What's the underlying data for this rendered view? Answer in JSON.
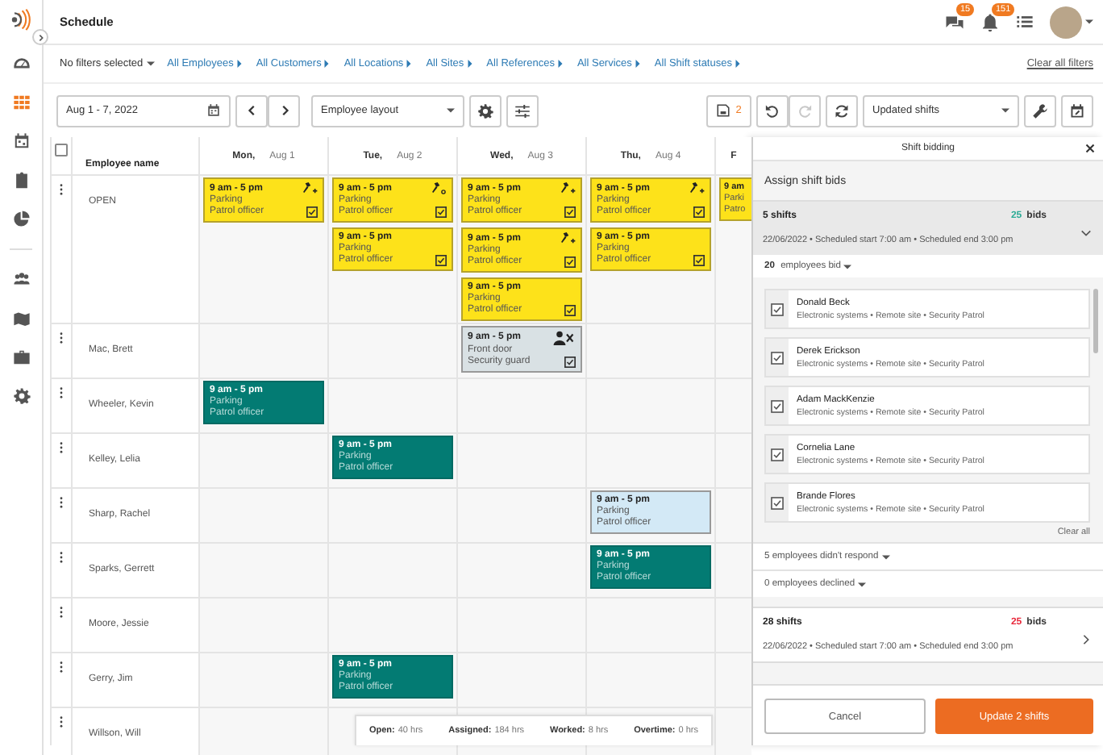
{
  "app": {
    "title": "Schedule"
  },
  "rail": [
    {
      "kind": "gauge",
      "selected": false
    },
    {
      "kind": "grid",
      "selected": true
    },
    {
      "kind": "calendar",
      "selected": false
    },
    {
      "kind": "clipboard",
      "selected": false
    },
    {
      "kind": "pie",
      "selected": false
    },
    {
      "kind": "people",
      "selected": false
    },
    {
      "kind": "map",
      "selected": false
    },
    {
      "kind": "briefcase",
      "selected": false
    },
    {
      "kind": "gear",
      "selected": false
    }
  ],
  "header": {
    "messages_badge": "15",
    "alerts_badge": "151"
  },
  "filters": {
    "summary": "No filters selected",
    "links": [
      "All Employees",
      "All Customers",
      "All Locations",
      "All Sites",
      "All References",
      "All Services",
      "All Shift statuses"
    ],
    "clear": "Clear all filters"
  },
  "toolbar": {
    "date_range": "Aug 1 - 7, 2022",
    "layout": "Employee layout",
    "unsaved_count": "2",
    "redo_disabled": true,
    "view": "Updated shifts"
  },
  "schedule": {
    "all_selected": false,
    "name_header": "Employee name",
    "days": [
      {
        "day": "Mon,",
        "date": "Aug 1"
      },
      {
        "day": "Tue,",
        "date": "Aug 2"
      },
      {
        "day": "Wed,",
        "date": "Aug 3"
      },
      {
        "day": "Thu,",
        "date": "Aug 4"
      },
      {
        "day": "F"
      }
    ],
    "rows": [
      {
        "name": "OPEN",
        "mon": [
          {
            "kind": "open",
            "time": "9 am - 5 pm",
            "location": "Parking",
            "role": "Patrol officer",
            "bid": {
              "kind": "new"
            },
            "confirmed": true
          }
        ],
        "tue": [
          {
            "kind": "open",
            "time": "9 am - 5 pm",
            "location": "Parking",
            "role": "Patrol officer",
            "bid": {
              "kind": "pending"
            },
            "confirmed": true
          },
          {
            "kind": "open",
            "time": "9 am - 5 pm",
            "location": "Parking",
            "role": "Patrol officer",
            "confirmed": true
          }
        ],
        "wed": [
          {
            "kind": "open",
            "time": "9 am - 5 pm",
            "location": "Parking",
            "role": "Patrol officer",
            "bid": {
              "kind": "new"
            },
            "confirmed": true
          },
          {
            "kind": "open",
            "time": "9 am - 5 pm",
            "location": "Parking",
            "role": "Patrol officer",
            "bid": {
              "kind": "new"
            },
            "confirmed": true
          },
          {
            "kind": "open",
            "time": "9 am - 5 pm",
            "location": "Parking",
            "role": "Patrol officer",
            "confirmed": true
          }
        ],
        "thu": [
          {
            "kind": "open",
            "time": "9 am - 5 pm",
            "location": "Parking",
            "role": "Patrol officer",
            "bid": {
              "kind": "new"
            },
            "confirmed": true
          },
          {
            "kind": "open",
            "time": "9 am - 5 pm",
            "location": "Parking",
            "role": "Patrol officer",
            "confirmed": true
          }
        ],
        "fri": [
          {
            "kind": "open",
            "time": "9 am",
            "location": "Parki",
            "role": "Patro"
          }
        ]
      },
      {
        "name": "Mac, Brett",
        "wed": [
          {
            "kind": "pending",
            "time": "9 am - 5 pm",
            "location": "Front door",
            "role": "Security guard",
            "confirmed": true
          }
        ]
      },
      {
        "name": "Wheeler, Kevin",
        "mon": [
          {
            "kind": "assigned",
            "time": "9 am - 5 pm",
            "location": "Parking",
            "role": "Patrol officer"
          }
        ]
      },
      {
        "name": "Kelley, Lelia",
        "tue": [
          {
            "kind": "assigned",
            "time": "9 am - 5 pm",
            "location": "Parking",
            "role": "Patrol officer"
          }
        ]
      },
      {
        "name": "Sharp, Rachel",
        "thu": [
          {
            "kind": "draft",
            "time": "9 am - 5 pm",
            "location": "Parking",
            "role": "Patrol officer"
          }
        ]
      },
      {
        "name": "Sparks, Gerrett",
        "thu": [
          {
            "kind": "assigned",
            "time": "9 am - 5 pm",
            "location": "Parking",
            "role": "Patrol officer"
          }
        ]
      },
      {
        "name": "Moore, Jessie"
      },
      {
        "name": "Gerry, Jim",
        "tue": [
          {
            "kind": "assigned",
            "time": "9 am - 5 pm",
            "location": "Parking",
            "role": "Patrol officer"
          }
        ]
      },
      {
        "name": "Willson, Will"
      }
    ],
    "summary": [
      {
        "label": "Open:",
        "value": "40 hrs"
      },
      {
        "label": "Assigned:",
        "value": "184 hrs"
      },
      {
        "label": "Worked:",
        "value": "8 hrs"
      },
      {
        "label": "Overtime:",
        "value": "0 hrs"
      }
    ]
  },
  "panel": {
    "title": "Shift bidding",
    "subtitle": "Assign shift bids",
    "groups": [
      {
        "shifts": "5 shifts",
        "bids": "25",
        "bids_label": "bids",
        "color": "#2bab95",
        "details": "22/06/2022 • Scheduled start 7:00 am • Scheduled end 3:00 pm",
        "expanded": true,
        "bidders": {
          "count": "20",
          "label": "employees bid",
          "employees": [
            {
              "name": "Donald Beck",
              "details": "Electronic systems • Remote site • Security Patrol",
              "checked": true
            },
            {
              "name": "Derek Erickson",
              "details": "Electronic systems • Remote site • Security Patrol",
              "checked": true
            },
            {
              "name": "Adam MackKenzie",
              "details": "Electronic systems • Remote site • Security Patrol",
              "checked": true
            },
            {
              "name": "Cornelia Lane",
              "details": "Electronic systems • Remote site • Security Patrol",
              "checked": true
            },
            {
              "name": "Brande Flores",
              "details": "Electronic systems • Remote site • Security Patrol",
              "checked": true
            }
          ],
          "clear": "Clear all",
          "no_response": {
            "count": "5",
            "label": "employees didn't respond"
          },
          "declined": {
            "count": "0",
            "label": "employees declined"
          }
        }
      },
      {
        "shifts": "28 shifts",
        "bids": "25",
        "bids_label": "bids",
        "color": "#e8273a",
        "details": "22/06/2022 • Scheduled start 7:00 am • Scheduled end 3:00 pm",
        "expanded": false
      }
    ],
    "cancel": "Cancel",
    "confirm": "Update 2 shifts"
  }
}
